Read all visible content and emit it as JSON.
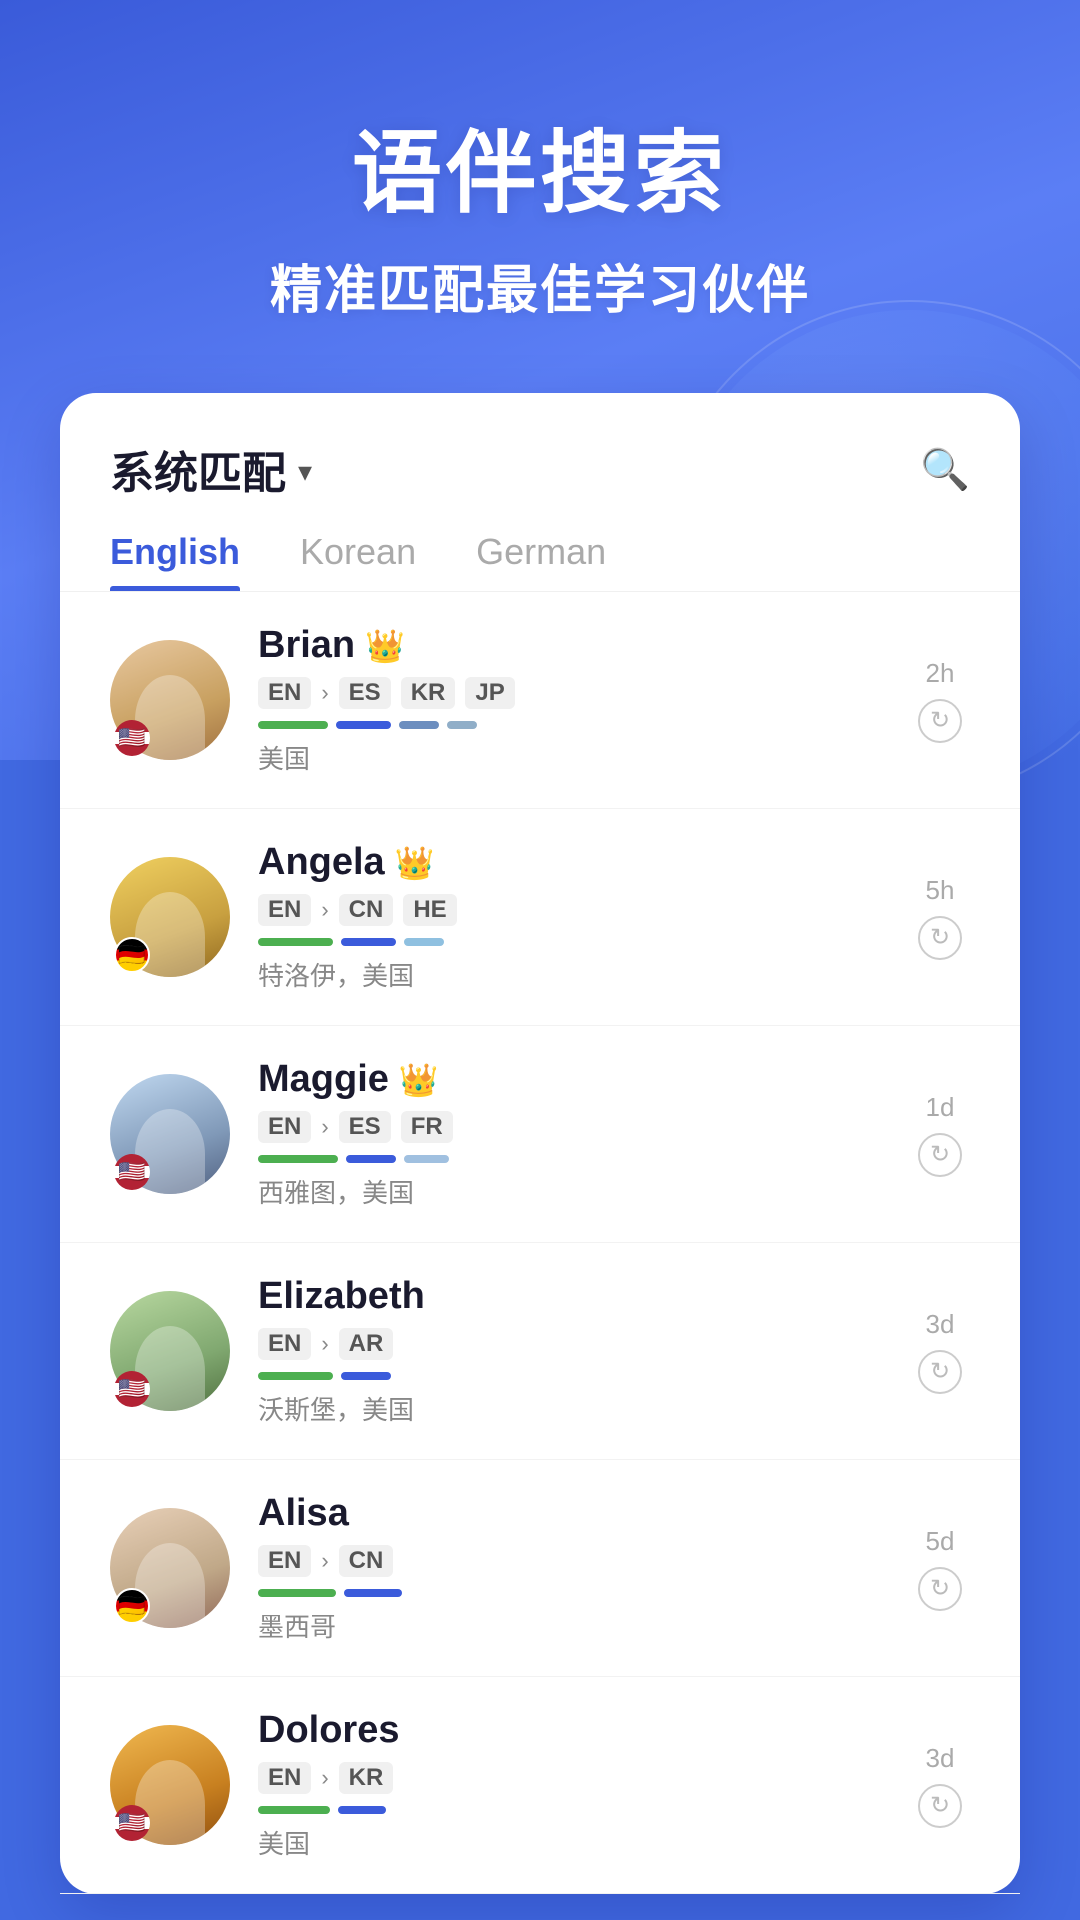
{
  "hero": {
    "title": "语伴搜索",
    "subtitle": "精准匹配最佳学习伙伴"
  },
  "filter": {
    "label": "系统匹配",
    "search_icon": "search"
  },
  "tabs": [
    {
      "id": "english",
      "label": "English",
      "active": true
    },
    {
      "id": "korean",
      "label": "Korean",
      "active": false
    },
    {
      "id": "german",
      "label": "German",
      "active": false
    }
  ],
  "users": [
    {
      "name": "Brian",
      "crown": true,
      "native": "EN",
      "learning": [
        "ES",
        "KR",
        "JP"
      ],
      "location": "美国",
      "time": "2h",
      "flag": "us",
      "bar_colors": [
        "#4CAF50",
        "#3b5bdb",
        "#6c8ebf",
        "#90aec8"
      ]
    },
    {
      "name": "Angela",
      "crown": true,
      "native": "EN",
      "learning": [
        "CN",
        "HE"
      ],
      "location": "特洛伊，美国",
      "time": "5h",
      "flag": "de",
      "bar_colors": [
        "#4CAF50",
        "#3b5bdb",
        "#8fc0e0"
      ]
    },
    {
      "name": "Maggie",
      "crown": true,
      "native": "EN",
      "learning": [
        "ES",
        "FR"
      ],
      "location": "西雅图，美国",
      "time": "1d",
      "flag": "us",
      "bar_colors": [
        "#4CAF50",
        "#3b5bdb",
        "#a0c0e0"
      ]
    },
    {
      "name": "Elizabeth",
      "crown": false,
      "native": "EN",
      "learning": [
        "AR"
      ],
      "location": "沃斯堡，美国",
      "time": "3d",
      "flag": "us",
      "bar_colors": [
        "#4CAF50",
        "#3b5bdb"
      ]
    },
    {
      "name": "Alisa",
      "crown": false,
      "native": "EN",
      "learning": [
        "CN"
      ],
      "location": "墨西哥",
      "time": "5d",
      "flag": "de",
      "bar_colors": [
        "#4CAF50",
        "#3b5bdb"
      ]
    },
    {
      "name": "Dolores",
      "crown": false,
      "native": "EN",
      "learning": [
        "KR"
      ],
      "location": "美国",
      "time": "3d",
      "flag": "us",
      "bar_colors": [
        "#4CAF50",
        "#3b5bdb"
      ]
    }
  ],
  "icons": {
    "crown": "👑",
    "search": "🔍",
    "chevron": "▾",
    "refresh": "↻",
    "arrow": "›"
  }
}
